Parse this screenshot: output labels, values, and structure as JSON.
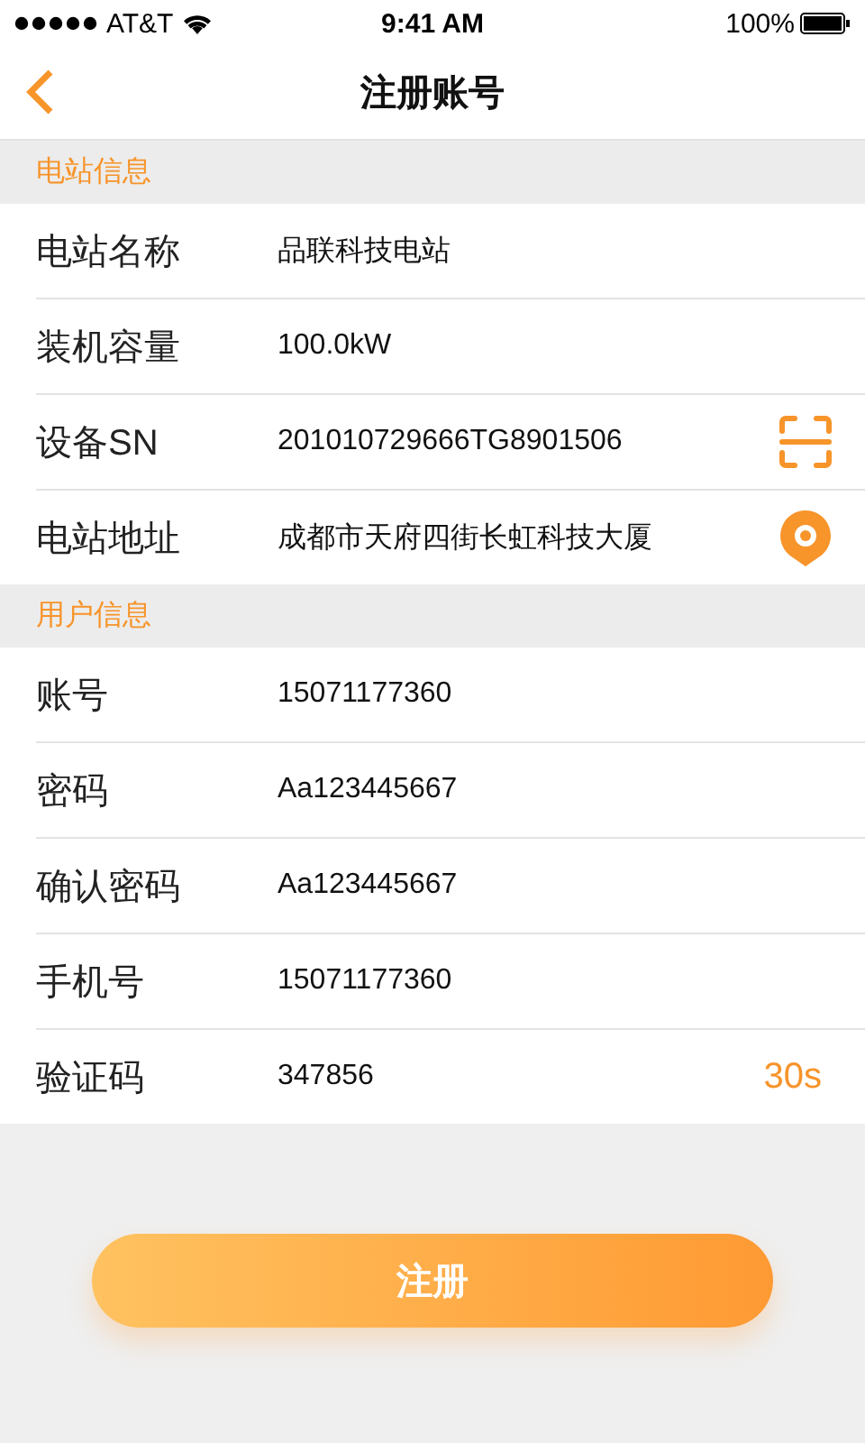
{
  "status_bar": {
    "carrier": "AT&T",
    "time": "9:41 AM",
    "battery": "100%"
  },
  "nav": {
    "title": "注册账号"
  },
  "sections": [
    {
      "title": "电站信息",
      "rows": [
        {
          "label": "电站名称",
          "value": "品联科技电站",
          "kind": "text"
        },
        {
          "label": "装机容量",
          "value": "100.0kW",
          "kind": "text"
        },
        {
          "label": "设备SN",
          "value": "201010729666TG8901506",
          "kind": "scan"
        },
        {
          "label": "电站地址",
          "value": "成都市天府四街长虹科技大厦",
          "kind": "location"
        }
      ]
    },
    {
      "title": "用户信息",
      "rows": [
        {
          "label": "账号",
          "value": "15071177360",
          "kind": "text"
        },
        {
          "label": "密码",
          "value": "Aa123445667",
          "kind": "text"
        },
        {
          "label": "确认密码",
          "value": "Aa123445667",
          "kind": "text"
        },
        {
          "label": "手机号",
          "value": "15071177360",
          "kind": "text"
        },
        {
          "label": "验证码",
          "value": "347856",
          "kind": "countdown",
          "action": "30s"
        }
      ]
    }
  ],
  "submit": "注册"
}
